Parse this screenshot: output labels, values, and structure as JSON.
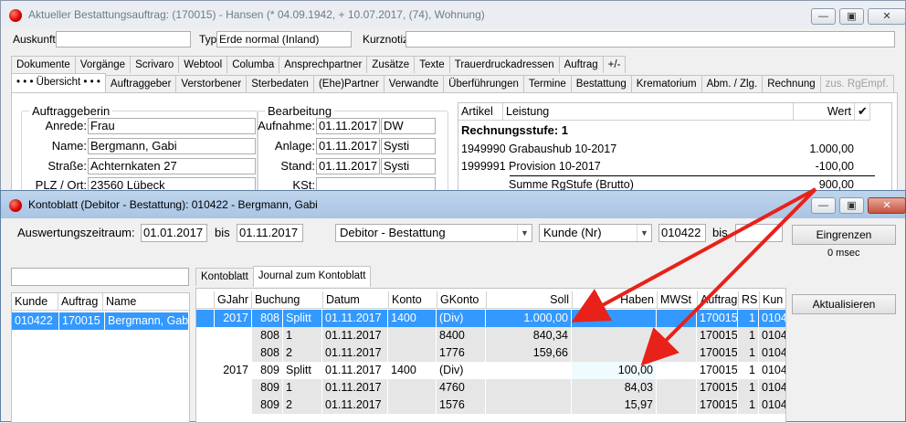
{
  "win1": {
    "title": "Aktueller Bestattungsauftrag: (170015) - Hansen (* 04.09.1942, + 10.07.2017, (74), Wohnung)",
    "auskunft_label": "Auskunft:",
    "auskunft_value": "",
    "typ_label": "Typ:",
    "typ_value": "Erde normal (Inland)",
    "kurznotiz_label": "Kurznotiz:",
    "kurznotiz_value": "",
    "tabs_top": [
      "Dokumente",
      "Vorgänge",
      "Scrivaro",
      "Webtool",
      "Columba",
      "Ansprechpartner",
      "Zusätze",
      "Texte",
      "Trauerdruckadressen",
      "Auftrag",
      "+/-"
    ],
    "tabs_bottom": [
      "• • •  Übersicht  • • •",
      "Auftraggeber",
      "Verstorbener",
      "Sterbedaten",
      "(Ehe)Partner",
      "Verwandte",
      "Überführungen",
      "Termine",
      "Bestattung",
      "Krematorium",
      "Abm. / Zlg.",
      "Rechnung",
      "zus. RgEmpf."
    ],
    "auftraggeberin": {
      "title": "Auftraggeberin",
      "anrede_label": "Anrede:",
      "anrede": "Frau",
      "name_label": "Name:",
      "name": "Bergmann, Gabi",
      "strasse_label": "Straße:",
      "strasse": "Achternkaten 27",
      "plz_label": "PLZ / Ort:",
      "plz": "23560 Lübeck"
    },
    "bearbeitung": {
      "title": "Bearbeitung",
      "aufnahme_label": "Aufnahme:",
      "aufnahme_date": "01.11.2017",
      "aufnahme_user": "DW",
      "anlage_label": "Anlage:",
      "anlage_date": "01.11.2017",
      "anlage_user": "Systi",
      "stand_label": "Stand:",
      "stand_date": "01.11.2017",
      "stand_user": "Systi",
      "kst_label": "KSt:",
      "kst": ""
    },
    "leistung": {
      "head_artikel": "Artikel",
      "head_leistung": "Leistung",
      "head_wert": "Wert",
      "stufe": "Rechnungsstufe:  1",
      "rows": [
        {
          "artikel": "1949990",
          "leistung": "Grabaushub 10-2017",
          "wert": "1.000,00"
        },
        {
          "artikel": "1999991",
          "leistung": "Provision 10-2017",
          "wert": "-100,00"
        }
      ],
      "summe_label": "Summe RgStufe (Brutto)",
      "summe_wert": "900,00"
    }
  },
  "win2": {
    "title": "Kontoblatt (Debitor - Bestattung): 010422 - Bergmann, Gabi",
    "zeitraum_label": "Auswertungszeitraum:",
    "von": "01.01.2017",
    "bis_label": "bis",
    "bis": "01.11.2017",
    "konto_typ": "Debitor - Bestattung",
    "sort": "Kunde (Nr)",
    "kunde_von": "010422",
    "bis2_label": "bis",
    "kunde_bis": "",
    "eingrenzen_label": "Eingrenzen",
    "timing": "0 msec",
    "aktualisieren_label": "Aktualisieren",
    "search_value": "",
    "tabs": [
      "Kontoblatt",
      "Journal zum Kontoblatt"
    ],
    "left_grid": {
      "headers": [
        "Kunde",
        "Auftrag",
        "Name"
      ],
      "rows": [
        {
          "kunde": "010422",
          "auftrag": "170015",
          "name": "Bergmann, Gabi"
        }
      ]
    },
    "journal": {
      "headers": [
        "GJahr",
        "Buchung",
        "",
        "Datum",
        "Konto",
        "GKonto",
        "Soll",
        "Haben",
        "MWSt",
        "Auftrag",
        "RS",
        "Kun"
      ],
      "rows": [
        {
          "gjahr": "2017",
          "buchung": "808",
          "pos": "Splitt",
          "datum": "01.11.2017",
          "konto": "1400",
          "gkonto": "(Div)",
          "soll": "1.000,00",
          "haben": "",
          "mwst": "",
          "auftrag": "170015",
          "rs": "1",
          "kun": "0104"
        },
        {
          "gjahr": "",
          "buchung": "808",
          "pos": "1",
          "datum": "01.11.2017",
          "konto": "",
          "gkonto": "8400",
          "soll": "840,34",
          "haben": "",
          "mwst": "",
          "auftrag": "170015",
          "rs": "1",
          "kun": "0104"
        },
        {
          "gjahr": "",
          "buchung": "808",
          "pos": "2",
          "datum": "01.11.2017",
          "konto": "",
          "gkonto": "1776",
          "soll": "159,66",
          "haben": "",
          "mwst": "",
          "auftrag": "170015",
          "rs": "1",
          "kun": "0104"
        },
        {
          "gjahr": "2017",
          "buchung": "809",
          "pos": "Splitt",
          "datum": "01.11.2017",
          "konto": "1400",
          "gkonto": "(Div)",
          "soll": "",
          "haben": "100,00",
          "mwst": "",
          "auftrag": "170015",
          "rs": "1",
          "kun": "0104"
        },
        {
          "gjahr": "",
          "buchung": "809",
          "pos": "1",
          "datum": "01.11.2017",
          "konto": "",
          "gkonto": "4760",
          "soll": "",
          "haben": "84,03",
          "mwst": "",
          "auftrag": "170015",
          "rs": "1",
          "kun": "0104"
        },
        {
          "gjahr": "",
          "buchung": "809",
          "pos": "2",
          "datum": "01.11.2017",
          "konto": "",
          "gkonto": "1576",
          "soll": "",
          "haben": "15,97",
          "mwst": "",
          "auftrag": "170015",
          "rs": "1",
          "kun": "0104"
        }
      ]
    }
  },
  "colors": {
    "selection": "#3399ff",
    "annotation_arrow": "#e8211a"
  }
}
